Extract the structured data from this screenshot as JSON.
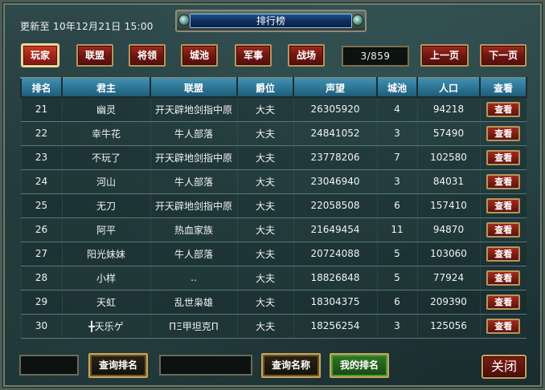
{
  "header": {
    "update_time": "更新至 10年12月21日 15:00",
    "title": "排行榜"
  },
  "categories": [
    {
      "label": "玩家",
      "active": true
    },
    {
      "label": "联盟",
      "active": false
    },
    {
      "label": "将领",
      "active": false
    },
    {
      "label": "城池",
      "active": false
    },
    {
      "label": "军事",
      "active": false
    },
    {
      "label": "战场",
      "active": false
    }
  ],
  "pagination": {
    "indicator": "3/859",
    "prev_label": "上一页",
    "next_label": "下一页"
  },
  "table": {
    "columns": [
      "排名",
      "君主",
      "联盟",
      "爵位",
      "声望",
      "城池",
      "人口",
      "查看"
    ],
    "view_label": "查看",
    "rows": [
      {
        "rank": "21",
        "lord": "幽灵",
        "alliance": "开天辟地剑指中原",
        "title": "大夫",
        "prestige": "26305920",
        "cities": "4",
        "population": "94218"
      },
      {
        "rank": "22",
        "lord": "幸牛花",
        "alliance": "牛人部落",
        "title": "大夫",
        "prestige": "24841052",
        "cities": "3",
        "population": "57490"
      },
      {
        "rank": "23",
        "lord": "不玩了",
        "alliance": "开天辟地剑指中原",
        "title": "大夫",
        "prestige": "23778206",
        "cities": "7",
        "population": "102580"
      },
      {
        "rank": "24",
        "lord": "河山",
        "alliance": "牛人部落",
        "title": "大夫",
        "prestige": "23046940",
        "cities": "3",
        "population": "84031"
      },
      {
        "rank": "25",
        "lord": "无刀",
        "alliance": "开天辟地剑指中原",
        "title": "大夫",
        "prestige": "22058508",
        "cities": "6",
        "population": "157410"
      },
      {
        "rank": "26",
        "lord": "阿平",
        "alliance": "热血家族",
        "title": "大夫",
        "prestige": "21649454",
        "cities": "11",
        "population": "94870"
      },
      {
        "rank": "27",
        "lord": "阳光妹妹",
        "alliance": "牛人部落",
        "title": "大夫",
        "prestige": "20724088",
        "cities": "5",
        "population": "103060"
      },
      {
        "rank": "28",
        "lord": "小样",
        "alliance": "..",
        "title": "大夫",
        "prestige": "18826848",
        "cities": "5",
        "population": "77924"
      },
      {
        "rank": "29",
        "lord": "天虹",
        "alliance": "乱世枭雄",
        "title": "大夫",
        "prestige": "18304375",
        "cities": "6",
        "population": "209390"
      },
      {
        "rank": "30",
        "lord": "╋天乐ゲ",
        "alliance": "ΠΞ甲坦克Π",
        "title": "大夫",
        "prestige": "18256254",
        "cities": "3",
        "population": "125056"
      }
    ]
  },
  "footer": {
    "rank_search_input": "",
    "rank_search_label": "查询排名",
    "name_search_input": "",
    "name_search_label": "查询名称",
    "my_rank_label": "我的排名",
    "close_label": "关闭"
  },
  "colors": {
    "accent_red": "#9c2217",
    "header_blue": "#2f7da0",
    "gold_border": "#c9a65a",
    "green_button": "#2f7a24"
  }
}
